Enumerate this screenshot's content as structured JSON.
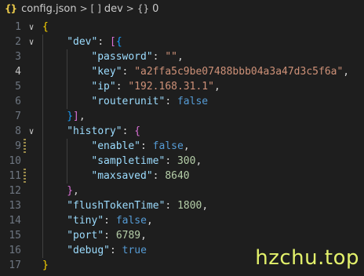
{
  "breadcrumb": {
    "file_icon": "{}",
    "file": "config.json",
    "segments": [
      {
        "icon": "[ ]",
        "icon_name": "array-icon",
        "label": "dev"
      },
      {
        "icon": "{}",
        "icon_name": "object-icon",
        "label": "0"
      }
    ]
  },
  "active_line": 4,
  "lines": [
    {
      "num": "1",
      "fold": "∨",
      "indent": 0,
      "tokens": [
        [
          "{",
          "br1"
        ]
      ]
    },
    {
      "num": "2",
      "fold": "∨",
      "indent": 1,
      "tokens": [
        [
          "\"dev\"",
          "k"
        ],
        [
          ": ",
          "p"
        ],
        [
          "[",
          "br2"
        ],
        [
          "{",
          "br3"
        ]
      ]
    },
    {
      "num": "3",
      "fold": "",
      "indent": 2,
      "tokens": [
        [
          "\"password\"",
          "k"
        ],
        [
          ": ",
          "p"
        ],
        [
          "\"\"",
          "s"
        ],
        [
          ",",
          "p"
        ]
      ]
    },
    {
      "num": "4",
      "fold": "",
      "indent": 2,
      "tokens": [
        [
          "\"key\"",
          "k"
        ],
        [
          ": ",
          "p"
        ],
        [
          "\"a2ffa5c9be07488bbb04a3a47d3c5f6a\"",
          "s"
        ],
        [
          ",",
          "p"
        ]
      ]
    },
    {
      "num": "5",
      "fold": "",
      "indent": 2,
      "tokens": [
        [
          "\"ip\"",
          "k"
        ],
        [
          ": ",
          "p"
        ],
        [
          "\"192.168.31.1\"",
          "s"
        ],
        [
          ",",
          "p"
        ]
      ]
    },
    {
      "num": "6",
      "fold": "",
      "indent": 2,
      "tokens": [
        [
          "\"routerunit\"",
          "k"
        ],
        [
          ": ",
          "p"
        ],
        [
          "false",
          "b"
        ]
      ]
    },
    {
      "num": "7",
      "fold": "",
      "indent": 1,
      "tokens": [
        [
          "}",
          "br3"
        ],
        [
          "]",
          "br2"
        ],
        [
          ",",
          "p"
        ]
      ]
    },
    {
      "num": "8",
      "fold": "∨",
      "indent": 1,
      "tokens": [
        [
          "\"history\"",
          "k"
        ],
        [
          ": ",
          "p"
        ],
        [
          "{",
          "br2"
        ]
      ]
    },
    {
      "num": "9",
      "fold": "",
      "indent": 2,
      "mark": true,
      "tokens": [
        [
          "\"enable\"",
          "k"
        ],
        [
          ": ",
          "p"
        ],
        [
          "false",
          "b"
        ],
        [
          ",",
          "p"
        ]
      ]
    },
    {
      "num": "10",
      "fold": "",
      "indent": 2,
      "tokens": [
        [
          "\"sampletime\"",
          "k"
        ],
        [
          ": ",
          "p"
        ],
        [
          "300",
          "n"
        ],
        [
          ",",
          "p"
        ]
      ]
    },
    {
      "num": "11",
      "fold": "",
      "indent": 2,
      "mark": true,
      "tokens": [
        [
          "\"maxsaved\"",
          "k"
        ],
        [
          ": ",
          "p"
        ],
        [
          "8640",
          "n"
        ]
      ]
    },
    {
      "num": "12",
      "fold": "",
      "indent": 1,
      "tokens": [
        [
          "}",
          "br2"
        ],
        [
          ",",
          "p"
        ]
      ]
    },
    {
      "num": "13",
      "fold": "",
      "indent": 1,
      "tokens": [
        [
          "\"flushTokenTime\"",
          "k"
        ],
        [
          ": ",
          "p"
        ],
        [
          "1800",
          "n"
        ],
        [
          ",",
          "p"
        ]
      ]
    },
    {
      "num": "14",
      "fold": "",
      "indent": 1,
      "tokens": [
        [
          "\"tiny\"",
          "k"
        ],
        [
          ": ",
          "p"
        ],
        [
          "false",
          "b"
        ],
        [
          ",",
          "p"
        ]
      ]
    },
    {
      "num": "15",
      "fold": "",
      "indent": 1,
      "tokens": [
        [
          "\"port\"",
          "k"
        ],
        [
          ": ",
          "p"
        ],
        [
          "6789",
          "n"
        ],
        [
          ",",
          "p"
        ]
      ]
    },
    {
      "num": "16",
      "fold": "",
      "indent": 1,
      "tokens": [
        [
          "\"debug\"",
          "k"
        ],
        [
          ": ",
          "p"
        ],
        [
          "true",
          "b"
        ]
      ]
    },
    {
      "num": "17",
      "fold": "",
      "indent": 0,
      "tokens": [
        [
          "}",
          "br1"
        ]
      ]
    }
  ],
  "watermark": "hzchu.top",
  "colors": {
    "background": "#1e1e1e",
    "key": "#9cdcfe",
    "string": "#ce9178",
    "number": "#b5cea8",
    "boolean": "#569cd6",
    "bracket_level1": "#ffd700",
    "bracket_level2": "#da70d6",
    "bracket_level3": "#179fff",
    "watermark": "#e3f16b"
  }
}
